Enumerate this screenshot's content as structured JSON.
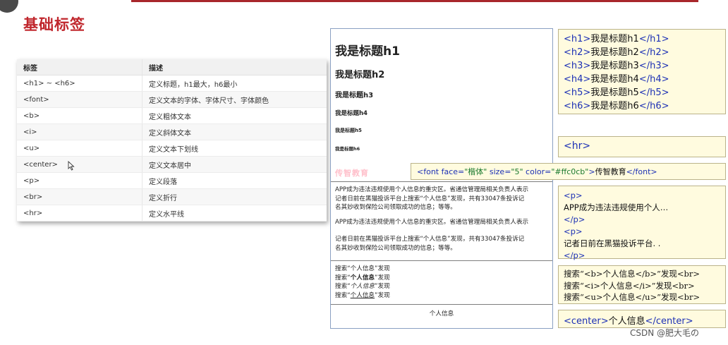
{
  "page_title": "基础标签",
  "table": {
    "headers": [
      "标签",
      "描述"
    ],
    "rows": [
      [
        "<h1> ~ <h6>",
        "定义标题，h1最大，h6最小"
      ],
      [
        "<font>",
        "定义文本的字体、字体尺寸、字体颜色"
      ],
      [
        "<b>",
        "定义粗体文本"
      ],
      [
        "<i>",
        "定义斜体文本"
      ],
      [
        "<u>",
        "定义文本下划线"
      ],
      [
        "<center>",
        "定义文本居中"
      ],
      [
        "<p>",
        "定义段落"
      ],
      [
        "<br>",
        "定义折行"
      ],
      [
        "<hr>",
        "定义水平线"
      ]
    ]
  },
  "demo": {
    "h1": "我是标题h1",
    "h2": "我是标题h2",
    "h3": "我是标题h3",
    "h4": "我是标题h4",
    "h5": "我是标题h5",
    "h6": "我是标题h6",
    "font_text": "传智教育",
    "font_color": "#ffc0cb",
    "para1_line1": "APP成为违法违规使用个人信息的重灾区。省通信管理局相关负责人表示",
    "para1_line2": "记者日前在黑猫投诉平台上搜索“个人信息”发现，共有33047条投诉记",
    "para1_line3": "名其妙收到保险公司领取成功的信息；等等。",
    "para2": "APP成为违法违规使用个人信息的重灾区。省通信管理局相关负责人表示",
    "para3_line1": "记者日前在黑猫投诉平台上搜索“个人信息”发现，共有33047条投诉记",
    "para3_line2": "名其妙收到保险公司领取成功的信息；等等。",
    "search_prefix": "搜索“",
    "keyword": "个人信息",
    "search_suffix": "”发现",
    "center_text": "个人信息"
  },
  "code": {
    "headings": [
      {
        "open": "<h1>",
        "text": "我是标题h1",
        "close": "</h1>"
      },
      {
        "open": "<h2>",
        "text": "我是标题h2",
        "close": "</h2>"
      },
      {
        "open": "<h3>",
        "text": "我是标题h3",
        "close": "</h3>"
      },
      {
        "open": "<h4>",
        "text": "我是标题h4",
        "close": "</h4>"
      },
      {
        "open": "<h5>",
        "text": "我是标题h5",
        "close": "</h5>"
      },
      {
        "open": "<h6>",
        "text": "我是标题h6",
        "close": "</h6>"
      }
    ],
    "hr": "<hr>",
    "font_open": "<font face=",
    "font_face": "\"楷体\"",
    "font_size_attr": " size=",
    "font_size": "\"5\"",
    "font_color_attr": " color=",
    "font_color_val": "\"#ffc0cb\"",
    "font_close_bracket": ">",
    "font_text": "传智教育",
    "font_end": "</font>",
    "p_open": "<p>",
    "p_close": "</p>",
    "p1_text": "APP成为违法违规使用个人…",
    "p2_text": "记者日前在黑猫投诉平台. .",
    "bi_lines": [
      "搜索“<b>个人信息</b>”发现<br>",
      "搜索“<i>个人信息</i>”发现<br>",
      "搜索“<u>个人信息</u>”发现<br>"
    ],
    "center_open": "<center>",
    "center_text": "个人信息",
    "center_close": "</center>"
  },
  "watermark": "CSDN @肥大毛の"
}
